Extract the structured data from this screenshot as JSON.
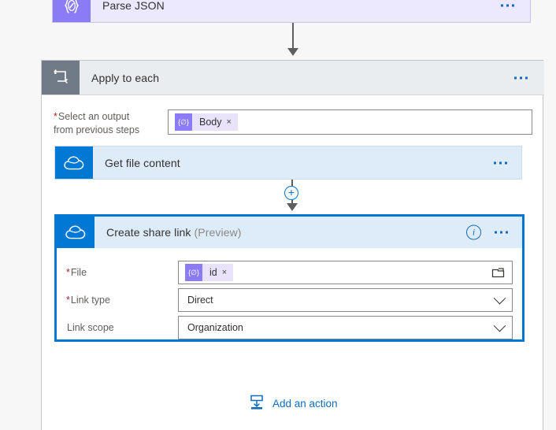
{
  "flow": {
    "parse_json": {
      "title": "Parse JSON",
      "icon": "json-braces-icon",
      "accent": "#8b7cf6",
      "menu": "more-options"
    },
    "apply_to_each": {
      "title": "Apply to each",
      "icon": "loop-icon",
      "accent": "#717b87",
      "menu": "more-options",
      "field": {
        "label_line1": "Select an output",
        "label_line2": "from previous steps",
        "required": "*",
        "token": {
          "text": "Body",
          "icon": "expression-icon",
          "remove": "×"
        }
      }
    },
    "get_file_content": {
      "title": "Get file content",
      "icon": "onedrive-cloud-icon",
      "accent": "#0078d4",
      "menu": "more-options"
    },
    "insert_connector": {
      "plus": "+"
    },
    "create_share_link": {
      "title": "Create share link",
      "preview_tag": "(Preview)",
      "icon": "onedrive-cloud-icon",
      "accent": "#0078d4",
      "info": "i",
      "menu": "more-options",
      "selected": true,
      "fields": [
        {
          "label": "File",
          "required": "*",
          "kind": "token",
          "token": {
            "text": "id",
            "icon": "expression-icon",
            "remove": "×"
          },
          "picker_icon": "folder-icon"
        },
        {
          "label": "Link type",
          "required": "*",
          "kind": "select",
          "value": "Direct",
          "chevron": "chevron-down-icon"
        },
        {
          "label": "Link scope",
          "required": "",
          "kind": "select",
          "value": "Organization",
          "chevron": "chevron-down-icon"
        }
      ]
    },
    "add_action": {
      "label": "Add an action",
      "icon": "insert-action-icon",
      "color": "#0f6cbd"
    }
  }
}
